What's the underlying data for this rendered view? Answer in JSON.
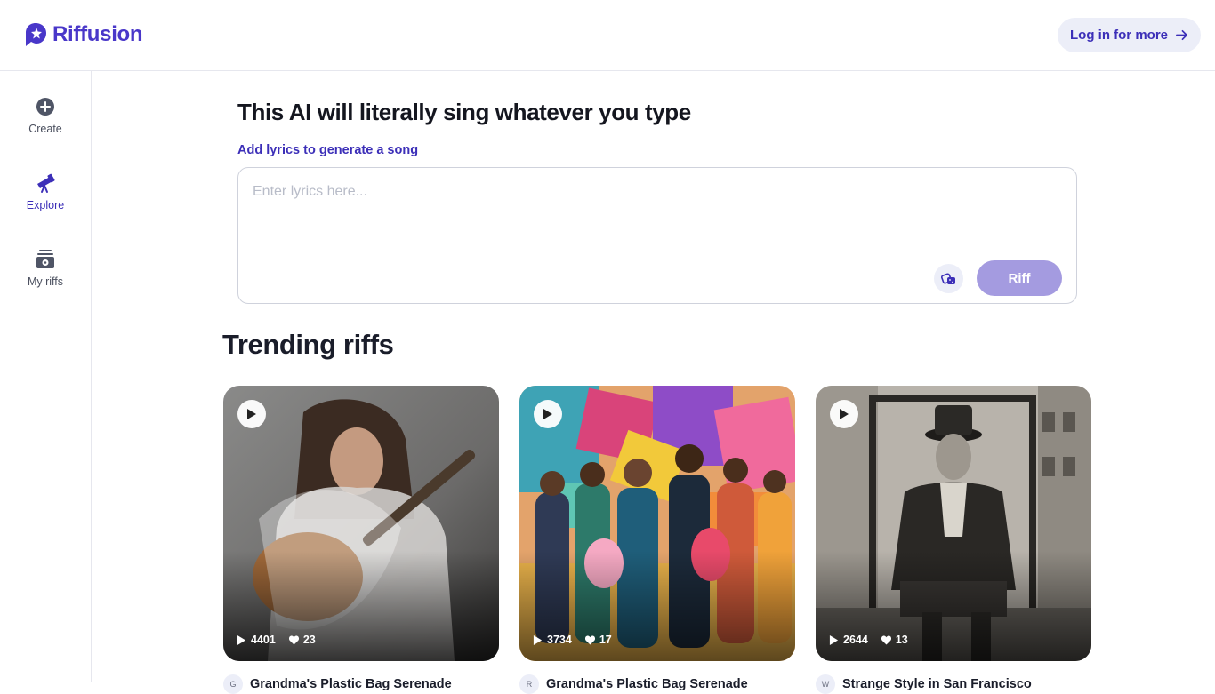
{
  "app": {
    "name": "Riffusion",
    "brand_color": "#4937c9"
  },
  "header": {
    "login_label": "Log in for more",
    "login_icon": "arrow-right-icon"
  },
  "sidebar": {
    "items": [
      {
        "label": "Create",
        "icon": "plus-circle-icon",
        "active": false
      },
      {
        "label": "Explore",
        "icon": "telescope-icon",
        "active": true
      },
      {
        "label": "My riffs",
        "icon": "library-icon",
        "active": false
      }
    ]
  },
  "hero": {
    "title": "This AI will literally sing whatever you type",
    "lyrics_label": "Add lyrics to generate a song",
    "lyrics_placeholder": "Enter lyrics here...",
    "lyrics_value": "",
    "dice_icon": "dice-icon",
    "riff_label": "Riff"
  },
  "trending": {
    "title": "Trending riffs",
    "cards": [
      {
        "plays": "4401",
        "likes": "23",
        "avatar": "G",
        "title": "Grandma's Plastic Bag Serenade"
      },
      {
        "plays": "3734",
        "likes": "17",
        "avatar": "R",
        "title": "Grandma's Plastic Bag Serenade"
      },
      {
        "plays": "2644",
        "likes": "13",
        "avatar": "W",
        "title": "Strange Style in San Francisco"
      }
    ]
  }
}
